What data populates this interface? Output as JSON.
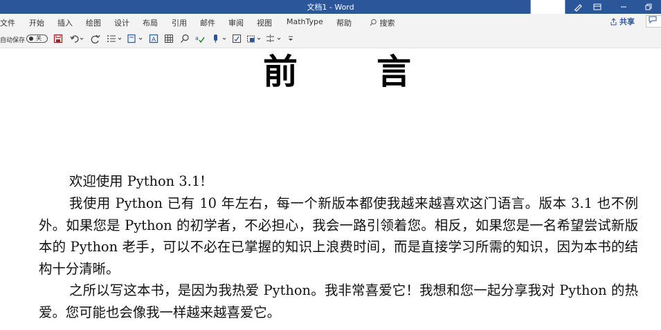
{
  "window": {
    "title": "文档1  -  Word"
  },
  "menu": {
    "items": [
      "文件",
      "开始",
      "插入",
      "绘图",
      "设计",
      "布局",
      "引用",
      "邮件",
      "审阅",
      "视图",
      "MathType",
      "帮助"
    ],
    "search": "搜索",
    "share": "共享"
  },
  "qat": {
    "autosave": "自动保存",
    "toggle": "关"
  },
  "document": {
    "heading": [
      "前",
      "言"
    ],
    "paragraphs": [
      "欢迎使用 Python 3.1!",
      "我使用 Python 已有 10 年左右，每一个新版本都使我越来越喜欢这门语言。版本 3.1 也不例外。如果您是 Python 的初学者，不必担心，我会一路引领着您。相反，如果您是一名希望尝试新版本的 Python 老手，可以不必在已掌握的知识上浪费时间，而是直接学习所需的知识，因为本书的结构十分清晰。",
      "之所以写这本书，是因为我热爱 Python。我非常喜爱它！我想和您一起分享我对 Python 的热爱。您可能也会像我一样越来越喜爱它。"
    ]
  },
  "colors": {
    "titlebar": "#2b579a",
    "ribbon": "#f3f3f3",
    "save_icon": "#a4262c"
  }
}
